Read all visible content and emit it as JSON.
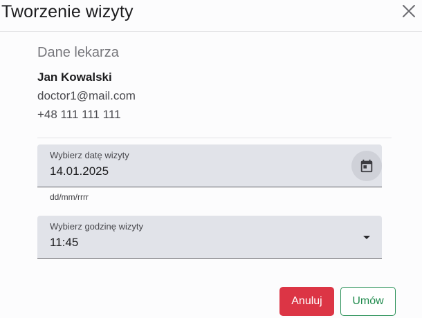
{
  "dialog": {
    "title": "Tworzenie wizyty",
    "close_icon": "close-icon"
  },
  "doctor": {
    "section_title": "Dane lekarza",
    "name": "Jan Kowalski",
    "email": "doctor1@mail.com",
    "phone": "+48 111 111 111"
  },
  "date_field": {
    "label": "Wybierz datę wizyty",
    "value": "14.01.2025",
    "hint": "dd/mm/rrrr",
    "icon": "calendar-icon"
  },
  "time_field": {
    "label": "Wybierz godzinę wizyty",
    "value": "11:45",
    "icon": "dropdown-arrow-icon"
  },
  "actions": {
    "cancel_label": "Anuluj",
    "submit_label": "Umów"
  },
  "colors": {
    "cancel_bg": "#dc3545",
    "submit_border": "#2a9158",
    "submit_text": "#1f8a4c",
    "field_bg": "#e1e3e9"
  }
}
